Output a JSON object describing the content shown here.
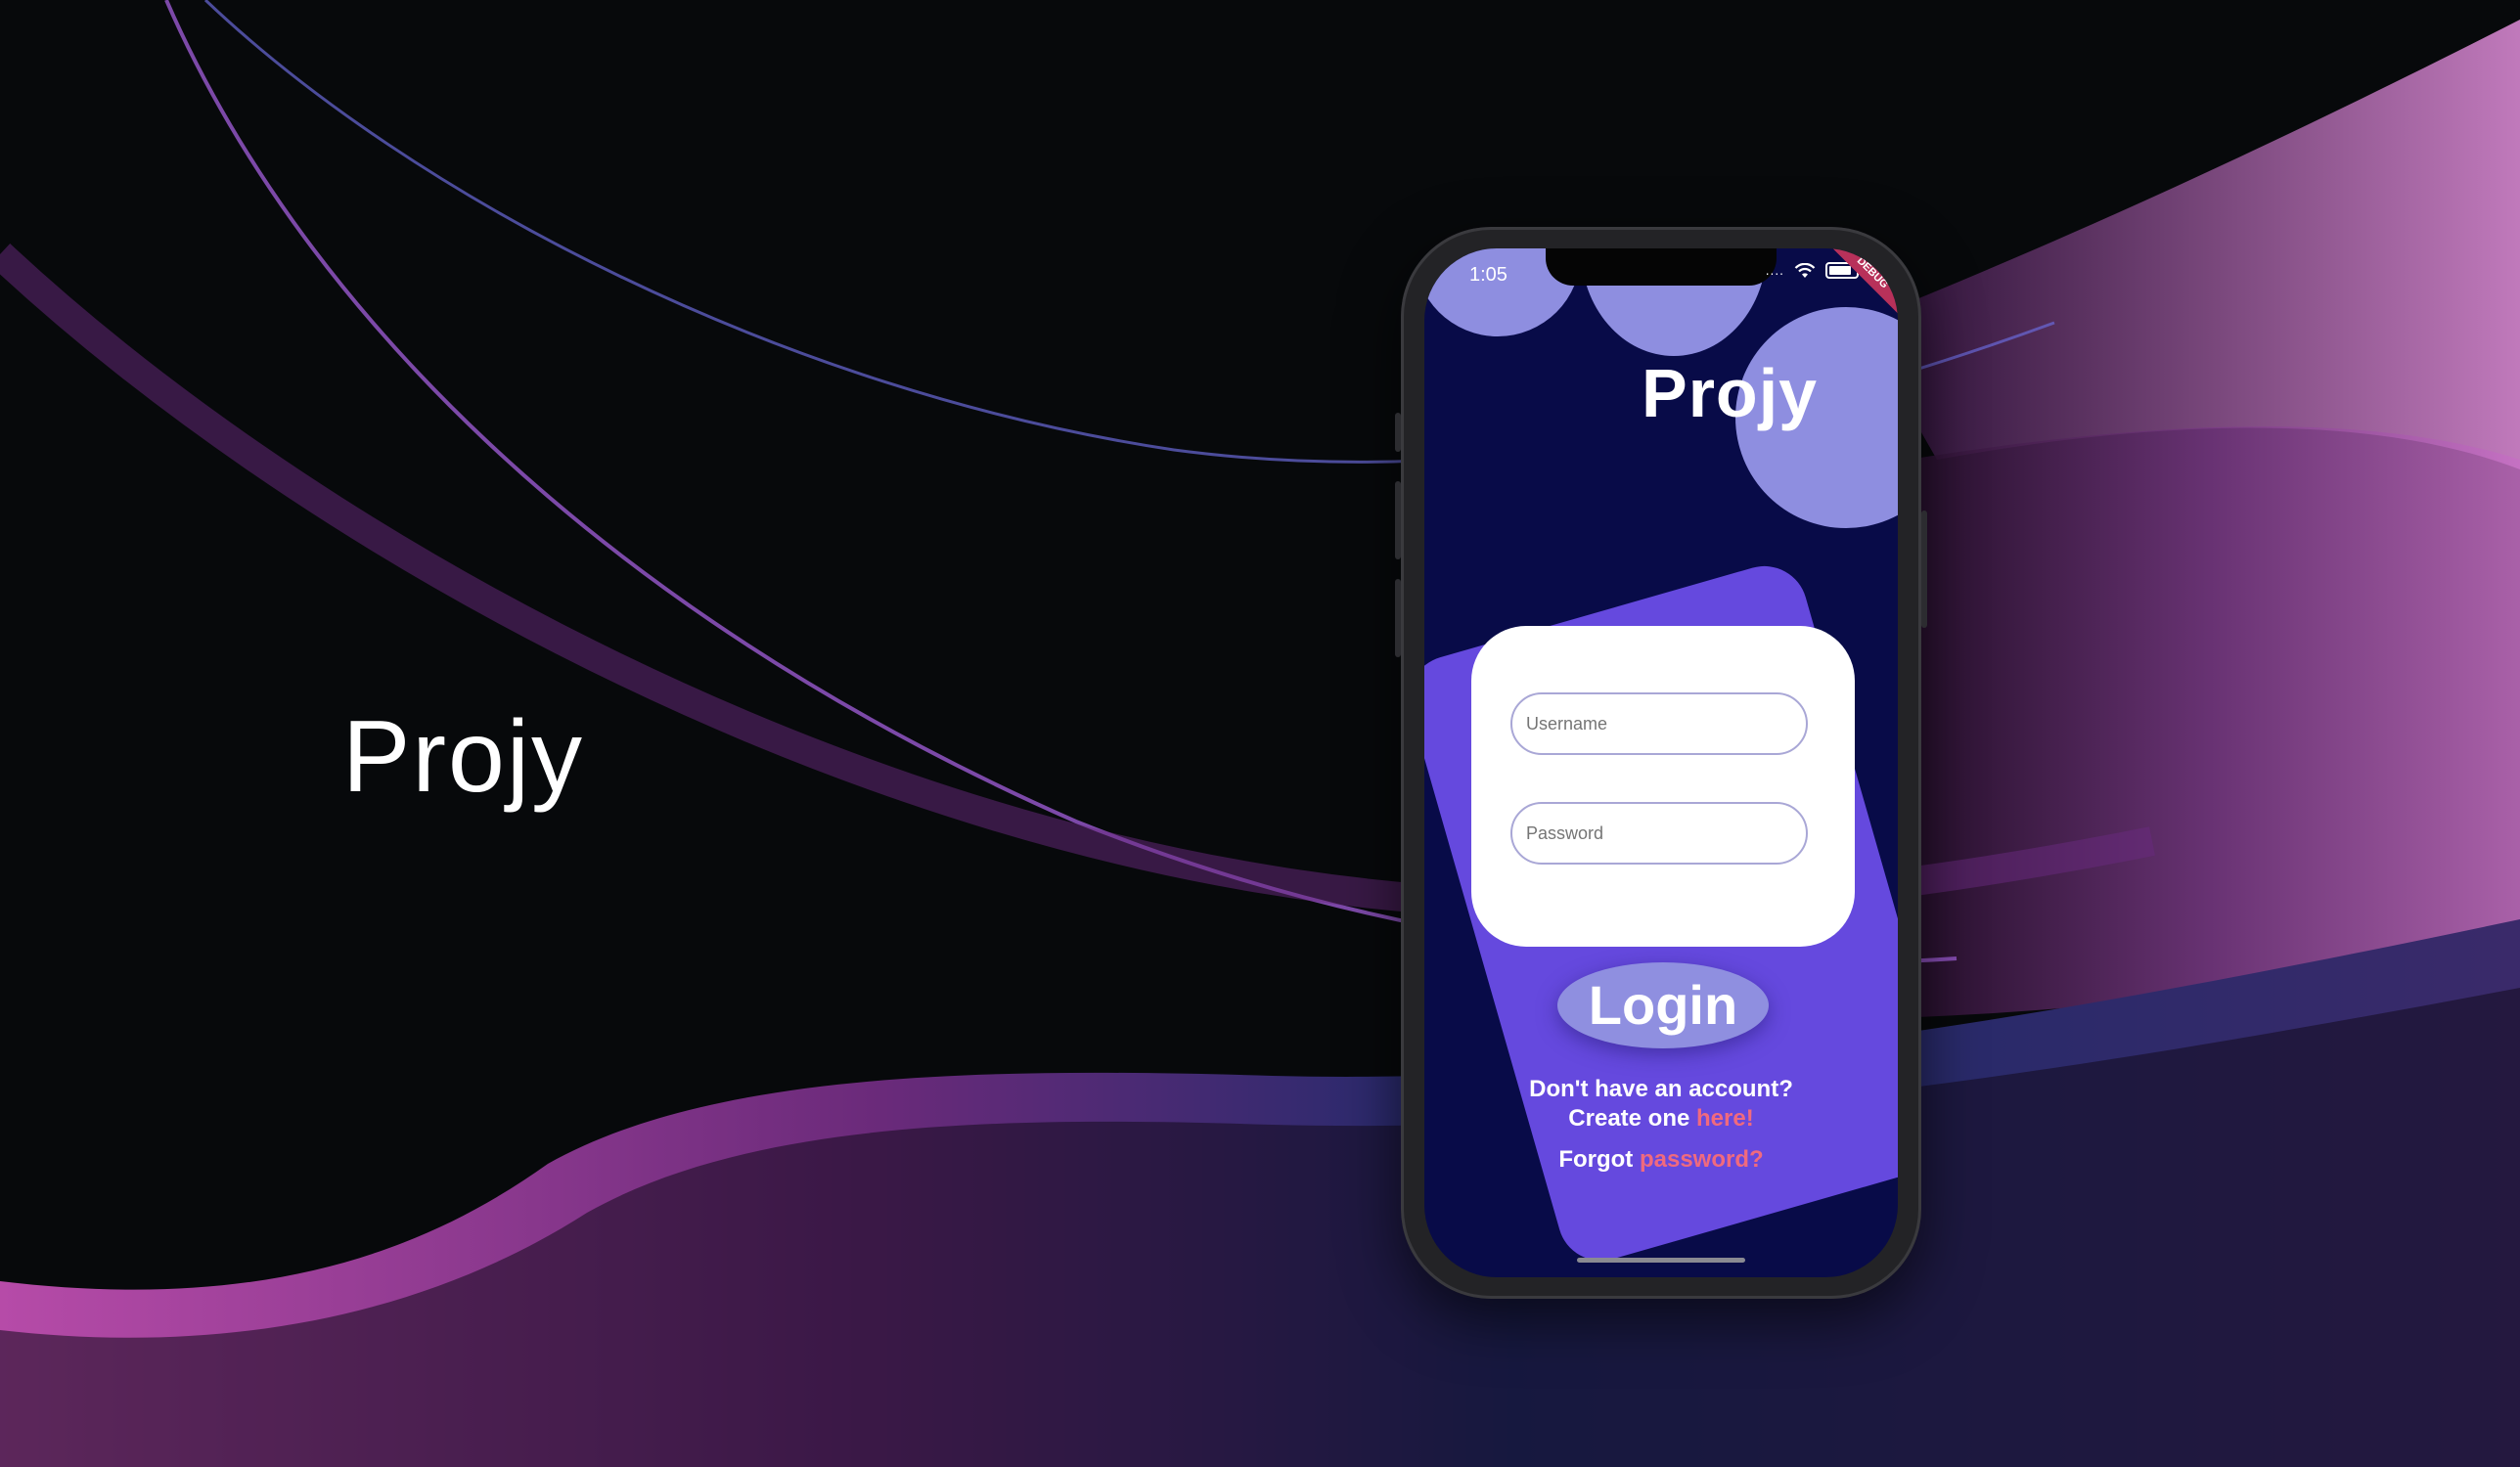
{
  "hero": {
    "title": "Projy"
  },
  "app": {
    "status_time": "1:05",
    "status_dots": "....",
    "debug_label": "DEBUG",
    "title": "Projy",
    "username_placeholder": "Username",
    "password_placeholder": "Password",
    "login_label": "Login",
    "no_account_text": "Don't have an account?",
    "create_prefix": "Create one ",
    "create_link": "here!",
    "forgot_prefix": "Forgot ",
    "forgot_link": "password?"
  },
  "colors": {
    "screen_bg": "#080b48",
    "card_bg": "#6549de",
    "deco_circle": "#8e8ee0",
    "link": "#f06a7e",
    "login_button": "#8f8fe0"
  },
  "icons": [
    "wifi-icon",
    "battery-icon"
  ]
}
